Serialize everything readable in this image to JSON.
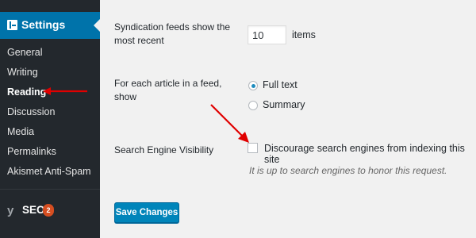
{
  "sidebar": {
    "settings_label": "Settings",
    "items": [
      {
        "label": "General",
        "current": false
      },
      {
        "label": "Writing",
        "current": false
      },
      {
        "label": "Reading",
        "current": true
      },
      {
        "label": "Discussion",
        "current": false
      },
      {
        "label": "Media",
        "current": false
      },
      {
        "label": "Permalinks",
        "current": false
      },
      {
        "label": "Akismet Anti-Spam",
        "current": false
      }
    ],
    "seo_label": "SEO",
    "seo_badge": "2"
  },
  "form": {
    "syndication": {
      "label_line1": "Syndication feeds show the",
      "label_line2": "most recent",
      "value": "10",
      "suffix": "items"
    },
    "feed_article": {
      "label_line1": "For each article in a feed,",
      "label_line2": "show",
      "options": [
        {
          "label": "Full text",
          "checked": true
        },
        {
          "label": "Summary",
          "checked": false
        }
      ]
    },
    "search_visibility": {
      "label": "Search Engine Visibility",
      "checkbox_label": "Discourage search engines from indexing this site",
      "checked": false,
      "description": "It is up to search engines to honor this request."
    },
    "save_button": "Save Changes"
  },
  "colors": {
    "sidebar_bg": "#23282d",
    "active_bg": "#0073aa",
    "button_bg": "#0085ba",
    "annotation_arrow": "#e00000",
    "badge": "#d54e21"
  }
}
